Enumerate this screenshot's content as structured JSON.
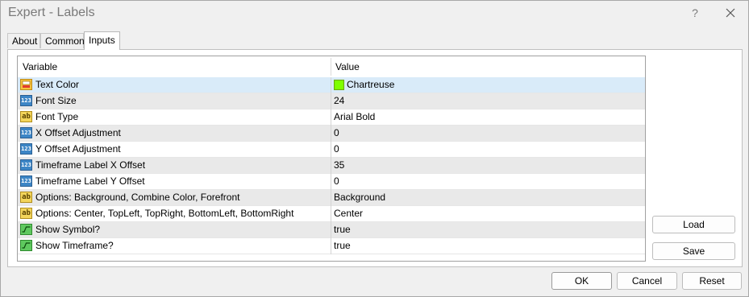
{
  "window": {
    "title": "Expert - Labels",
    "help_label": "?"
  },
  "tabs": [
    {
      "label": "About",
      "active": false
    },
    {
      "label": "Common",
      "active": false
    },
    {
      "label": "Inputs",
      "active": true
    }
  ],
  "grid": {
    "headers": {
      "variable": "Variable",
      "value": "Value"
    },
    "rows": [
      {
        "icon": "color-icon",
        "variable": "Text Color",
        "value": "Chartreuse",
        "swatch": "#7fff00",
        "selected": true
      },
      {
        "icon": "number-icon",
        "variable": "Font Size",
        "value": "24"
      },
      {
        "icon": "text-icon",
        "variable": "Font Type",
        "value": "Arial Bold"
      },
      {
        "icon": "number-icon",
        "variable": "X Offset Adjustment",
        "value": "0"
      },
      {
        "icon": "number-icon",
        "variable": "Y Offset Adjustment",
        "value": "0"
      },
      {
        "icon": "number-icon",
        "variable": "Timeframe Label X Offset",
        "value": "35"
      },
      {
        "icon": "number-icon",
        "variable": "Timeframe Label Y Offset",
        "value": "0"
      },
      {
        "icon": "text-icon",
        "variable": "Options: Background, Combine Color, Forefront",
        "value": "Background"
      },
      {
        "icon": "text-icon",
        "variable": "Options: Center, TopLeft, TopRight, BottomLeft, BottomRight",
        "value": "Center"
      },
      {
        "icon": "bool-icon",
        "variable": "Show Symbol?",
        "value": "true"
      },
      {
        "icon": "bool-icon",
        "variable": "Show Timeframe?",
        "value": "true"
      }
    ]
  },
  "side_buttons": {
    "load": "Load",
    "save": "Save"
  },
  "footer_buttons": {
    "ok": "OK",
    "cancel": "Cancel",
    "reset": "Reset"
  },
  "colors": {
    "selection": "#d9ebf9",
    "alt_row": "#e9e9e9"
  }
}
